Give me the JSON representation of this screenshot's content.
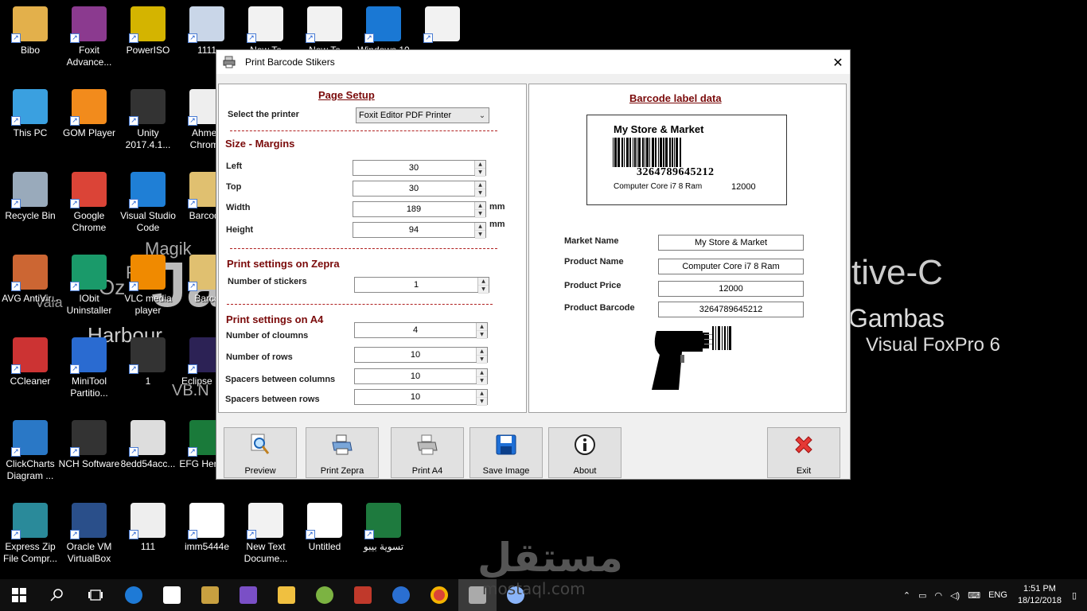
{
  "desktop": {
    "wallpaper": [
      "Magik",
      "Ja",
      "tive-C",
      "Gambas",
      "Visual FoxPro 6",
      "Harbour",
      "VB.N",
      "Vala",
      "Oz",
      "R"
    ],
    "icons": [
      {
        "label": "Bibo",
        "color": "#e3b04b"
      },
      {
        "label": "Foxit Advance...",
        "color": "#8b3a8f"
      },
      {
        "label": "PowerISO",
        "color": "#d4b400"
      },
      {
        "label": "1111",
        "color": "#c9d6e8"
      },
      {
        "label": "New Te",
        "color": "#f2f2f2"
      },
      {
        "label": "New Te",
        "color": "#f2f2f2"
      },
      {
        "label": "Windows 10",
        "color": "#1a78d4"
      },
      {
        "label": "",
        "color": "#f2f2f2"
      },
      {
        "label": "This PC",
        "color": "#3aa0e0"
      },
      {
        "label": "GOM Player",
        "color": "#f28b1c"
      },
      {
        "label": "Unity 2017.4.1...",
        "color": "#333"
      },
      {
        "label": "Ahmed Chrome",
        "color": "#eee"
      },
      {
        "label": "Recycle Bin",
        "color": "#9ab"
      },
      {
        "label": "Google Chrome",
        "color": "#db4437"
      },
      {
        "label": "Visual Studio Code",
        "color": "#1f7fd6"
      },
      {
        "label": "Barcode",
        "color": "#e0c070"
      },
      {
        "label": "AVG AntiVir...",
        "color": "#c63"
      },
      {
        "label": "IObit Uninstaller",
        "color": "#1a9a6a"
      },
      {
        "label": "VLC media player",
        "color": "#f08a00"
      },
      {
        "label": "Barco",
        "color": "#e0c070"
      },
      {
        "label": "CCleaner",
        "color": "#c33"
      },
      {
        "label": "MiniTool Partitio...",
        "color": "#2a6bd1"
      },
      {
        "label": "1",
        "color": "#333"
      },
      {
        "label": "Eclipse Neo",
        "color": "#2c2255"
      },
      {
        "label": "ClickCharts Diagram ...",
        "color": "#2a78c6"
      },
      {
        "label": "NCH Software",
        "color": "#333"
      },
      {
        "label": "8edd54acc...",
        "color": "#ddd"
      },
      {
        "label": "EFG Her Pro",
        "color": "#1a7a3a"
      },
      {
        "label": "Express Zip File Compr...",
        "color": "#2a8a9a"
      },
      {
        "label": "Oracle VM VirtualBox",
        "color": "#2a4f8a"
      },
      {
        "label": "111",
        "color": "#eee"
      },
      {
        "label": "imm5444e",
        "color": "#fff"
      },
      {
        "label": "New Text Docume...",
        "color": "#f2f2f2"
      },
      {
        "label": "Untitled",
        "color": "#fff"
      },
      {
        "label": "تسوية بيبو",
        "color": "#1e7a3e"
      }
    ]
  },
  "window": {
    "title": "Print Barcode Stikers",
    "page_setup": {
      "title": "Page Setup",
      "printer_label": "Select the printer",
      "printer_value": "Foxit Editor PDF Printer"
    },
    "size_margins": {
      "title": "Size - Margins",
      "left_label": "Left",
      "left_value": "30",
      "top_label": "Top",
      "top_value": "30",
      "width_label": "Width",
      "width_value": "189",
      "width_unit": "mm",
      "height_label": "Height",
      "height_value": "94",
      "height_unit": "mm"
    },
    "zepra": {
      "title": "Print settings on Zepra",
      "stickers_label": "Number of  stickers",
      "stickers_value": "1"
    },
    "a4": {
      "title": "Print settings on A4",
      "columns_label": "Number of cloumns",
      "columns_value": "4",
      "rows_label": "Number of rows",
      "rows_value": "10",
      "spacers_cols_label": "Spacers between columns",
      "spacers_cols_value": "10",
      "spacers_rows_label": "Spacers between rows",
      "spacers_rows_value": "10"
    },
    "label_data": {
      "title": "Barcode label data",
      "preview_store": "My Store & Market",
      "preview_code": "3264789645212",
      "preview_product": "Computer Core i7 8 Ram",
      "preview_price": "12000",
      "market_label": "Market Name",
      "market_value": "My Store & Market",
      "product_label": "Product Name",
      "product_value": "Computer Core i7 8 Ram",
      "price_label": "Product Price",
      "price_value": "12000",
      "barcode_label": "Product Barcode",
      "barcode_value": "3264789645212"
    },
    "buttons": {
      "preview": "Preview",
      "print_zepra": "Print Zepra",
      "print_a4": "Print A4",
      "save_image": "Save Image",
      "about": "About",
      "exit": "Exit"
    }
  },
  "taskbar": {
    "lang": "ENG",
    "time": "1:51 PM",
    "date": "18/12/2018"
  },
  "watermark": {
    "text": "مستقل",
    "sub": "mostaql.com"
  },
  "colors": {
    "section_title": "#7a0a0a",
    "dash": "#b02020",
    "exit_red": "#e53935"
  }
}
